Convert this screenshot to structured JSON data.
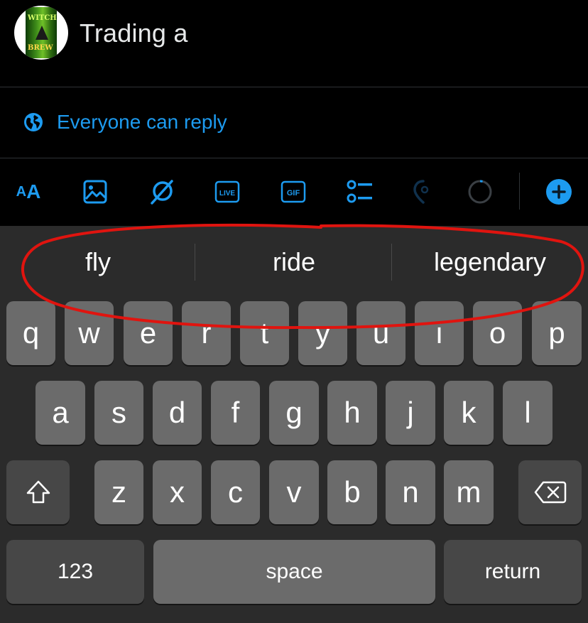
{
  "compose": {
    "avatar_text_top": "WITCH",
    "avatar_text_bottom": "BREW",
    "draft_text": "Trading a"
  },
  "reply_setting": {
    "label": "Everyone can reply",
    "icon": "globe-icon"
  },
  "toolbar": {
    "aa_small": "A",
    "aa_big": "A",
    "icons": [
      "text-format-icon",
      "image-icon",
      "grok-icon",
      "live-icon",
      "gif-icon",
      "poll-icon",
      "location-icon",
      "character-count-icon",
      "add-post-icon"
    ],
    "live_label": "LIVE",
    "gif_label": "GIF",
    "accent": "#1d9bf0"
  },
  "keyboard": {
    "suggestions": [
      "fly",
      "ride",
      "legendary"
    ],
    "row1": [
      "q",
      "w",
      "e",
      "r",
      "t",
      "y",
      "u",
      "i",
      "o",
      "p"
    ],
    "row2": [
      "a",
      "s",
      "d",
      "f",
      "g",
      "h",
      "j",
      "k",
      "l"
    ],
    "row3": [
      "z",
      "x",
      "c",
      "v",
      "b",
      "n",
      "m"
    ],
    "numbers_label": "123",
    "space_label": "space",
    "return_label": "return"
  },
  "annotation": {
    "shape": "hand-drawn red ellipse around suggestions",
    "color": "#e0140f"
  }
}
